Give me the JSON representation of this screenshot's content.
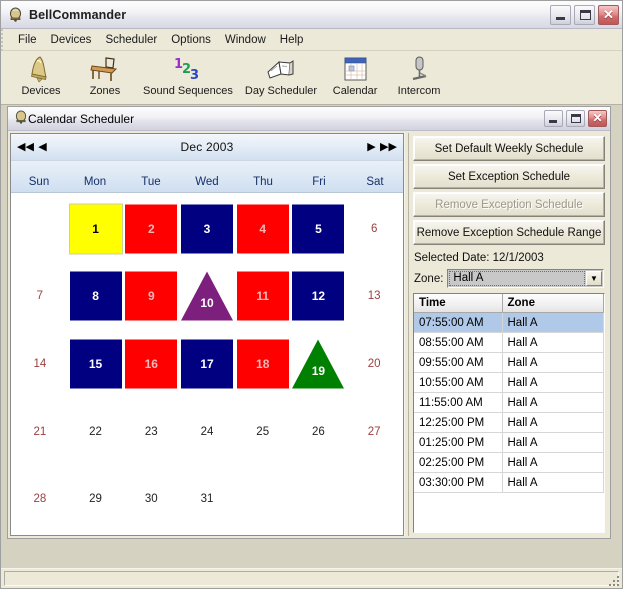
{
  "app": {
    "title": "BellCommander",
    "icon": "bell-app-icon",
    "window_buttons": [
      {
        "name": "minimize",
        "glyph": "_"
      },
      {
        "name": "maximize",
        "glyph": "□"
      },
      {
        "name": "close",
        "glyph": "✕"
      }
    ]
  },
  "menu": {
    "items": [
      {
        "label": "File"
      },
      {
        "label": "Devices"
      },
      {
        "label": "Scheduler"
      },
      {
        "label": "Options"
      },
      {
        "label": "Window"
      },
      {
        "label": "Help"
      }
    ]
  },
  "toolbar": {
    "items": [
      {
        "label": "Devices",
        "icon": "bell-icon"
      },
      {
        "label": "Zones",
        "icon": "desk-chair-icon"
      },
      {
        "label": "Sound Sequences",
        "icon": "numbers-123-icon"
      },
      {
        "label": "Day Scheduler",
        "icon": "open-book-icon"
      },
      {
        "label": "Calendar",
        "icon": "calendar-icon"
      },
      {
        "label": "Intercom",
        "icon": "microphone-icon"
      }
    ]
  },
  "child_window": {
    "title": "Calendar Scheduler",
    "icon": "bell-app-icon",
    "window_buttons": [
      {
        "name": "minimize",
        "glyph": "_"
      },
      {
        "name": "maximize",
        "glyph": "□"
      },
      {
        "name": "close",
        "glyph": "✕"
      }
    ]
  },
  "calendar": {
    "month_label": "Dec 2003",
    "nav": {
      "first": "◀◀",
      "prev": "◀",
      "next": "▶",
      "last": "▶▶"
    },
    "day_headers": [
      "Sun",
      "Mon",
      "Tue",
      "Wed",
      "Thu",
      "Fri",
      "Sat"
    ],
    "colors": {
      "yellow": "#FFFF00",
      "red": "#FF0000",
      "navy": "#000080",
      "purple": "#7D1F7D",
      "green": "#008000",
      "weekend_text": "#9C4040",
      "weekday_text": "#222222",
      "selection_outline": "#CFCF9A"
    },
    "weeks": [
      [
        {
          "day": "",
          "kind": "empty"
        },
        {
          "day": "1",
          "kind": "square",
          "color": "#FFFF00",
          "text_color": "#000000",
          "selected": true
        },
        {
          "day": "2",
          "kind": "square",
          "color": "#FF0000",
          "text_color": "#F2B8B8"
        },
        {
          "day": "3",
          "kind": "square",
          "color": "#000080",
          "text_color": "#FFFFFF"
        },
        {
          "day": "4",
          "kind": "square",
          "color": "#FF0000",
          "text_color": "#F2B8B8"
        },
        {
          "day": "5",
          "kind": "square",
          "color": "#000080",
          "text_color": "#FFFFFF"
        },
        {
          "day": "6",
          "kind": "weekend"
        }
      ],
      [
        {
          "day": "7",
          "kind": "weekend"
        },
        {
          "day": "8",
          "kind": "square",
          "color": "#000080",
          "text_color": "#FFFFFF"
        },
        {
          "day": "9",
          "kind": "square",
          "color": "#FF0000",
          "text_color": "#F2B8B8"
        },
        {
          "day": "10",
          "kind": "triangle",
          "color": "#7D1F7D",
          "text_color": "#FFFFFF"
        },
        {
          "day": "11",
          "kind": "square",
          "color": "#FF0000",
          "text_color": "#F2B8B8"
        },
        {
          "day": "12",
          "kind": "square",
          "color": "#000080",
          "text_color": "#FFFFFF"
        },
        {
          "day": "13",
          "kind": "weekend"
        }
      ],
      [
        {
          "day": "14",
          "kind": "weekend"
        },
        {
          "day": "15",
          "kind": "square",
          "color": "#000080",
          "text_color": "#FFFFFF"
        },
        {
          "day": "16",
          "kind": "square",
          "color": "#FF0000",
          "text_color": "#F2B8B8"
        },
        {
          "day": "17",
          "kind": "square",
          "color": "#000080",
          "text_color": "#FFFFFF"
        },
        {
          "day": "18",
          "kind": "square",
          "color": "#FF0000",
          "text_color": "#F2B8B8"
        },
        {
          "day": "19",
          "kind": "triangle",
          "color": "#008000",
          "text_color": "#FFFFFF"
        },
        {
          "day": "20",
          "kind": "weekend"
        }
      ],
      [
        {
          "day": "21",
          "kind": "weekend"
        },
        {
          "day": "22",
          "kind": "plain"
        },
        {
          "day": "23",
          "kind": "plain"
        },
        {
          "day": "24",
          "kind": "plain"
        },
        {
          "day": "25",
          "kind": "plain"
        },
        {
          "day": "26",
          "kind": "plain"
        },
        {
          "day": "27",
          "kind": "weekend"
        }
      ],
      [
        {
          "day": "28",
          "kind": "weekend"
        },
        {
          "day": "29",
          "kind": "plain"
        },
        {
          "day": "30",
          "kind": "plain"
        },
        {
          "day": "31",
          "kind": "plain"
        },
        {
          "day": "",
          "kind": "empty"
        },
        {
          "day": "",
          "kind": "empty"
        },
        {
          "day": "",
          "kind": "empty"
        }
      ]
    ]
  },
  "panel": {
    "buttons": [
      {
        "label": "Set Default Weekly Schedule",
        "disabled": false
      },
      {
        "label": "Set Exception Schedule",
        "disabled": false
      },
      {
        "label": "Remove Exception Schedule",
        "disabled": true
      },
      {
        "label": "Remove Exception Schedule Range",
        "disabled": false
      }
    ],
    "selected_date_label": "Selected Date: 12/1/2003",
    "zone_label": "Zone:",
    "zone_value": "Hall A",
    "zone_options": [
      "Hall A"
    ],
    "dropdown_glyph": "▼"
  },
  "schedule_table": {
    "columns": [
      "Time",
      "Zone"
    ],
    "rows": [
      {
        "time": "07:55:00 AM",
        "zone": "Hall A",
        "selected": true
      },
      {
        "time": "08:55:00 AM",
        "zone": "Hall A",
        "selected": false
      },
      {
        "time": "09:55:00 AM",
        "zone": "Hall A",
        "selected": false
      },
      {
        "time": "10:55:00 AM",
        "zone": "Hall A",
        "selected": false
      },
      {
        "time": "11:55:00 AM",
        "zone": "Hall A",
        "selected": false
      },
      {
        "time": "12:25:00 PM",
        "zone": "Hall A",
        "selected": false
      },
      {
        "time": "01:25:00 PM",
        "zone": "Hall A",
        "selected": false
      },
      {
        "time": "02:25:00 PM",
        "zone": "Hall A",
        "selected": false
      },
      {
        "time": "03:30:00 PM",
        "zone": "Hall A",
        "selected": false
      }
    ],
    "selection_color": "#B0C9E8"
  },
  "statusbar": {
    "text": "",
    "grip": "resize-grip"
  }
}
